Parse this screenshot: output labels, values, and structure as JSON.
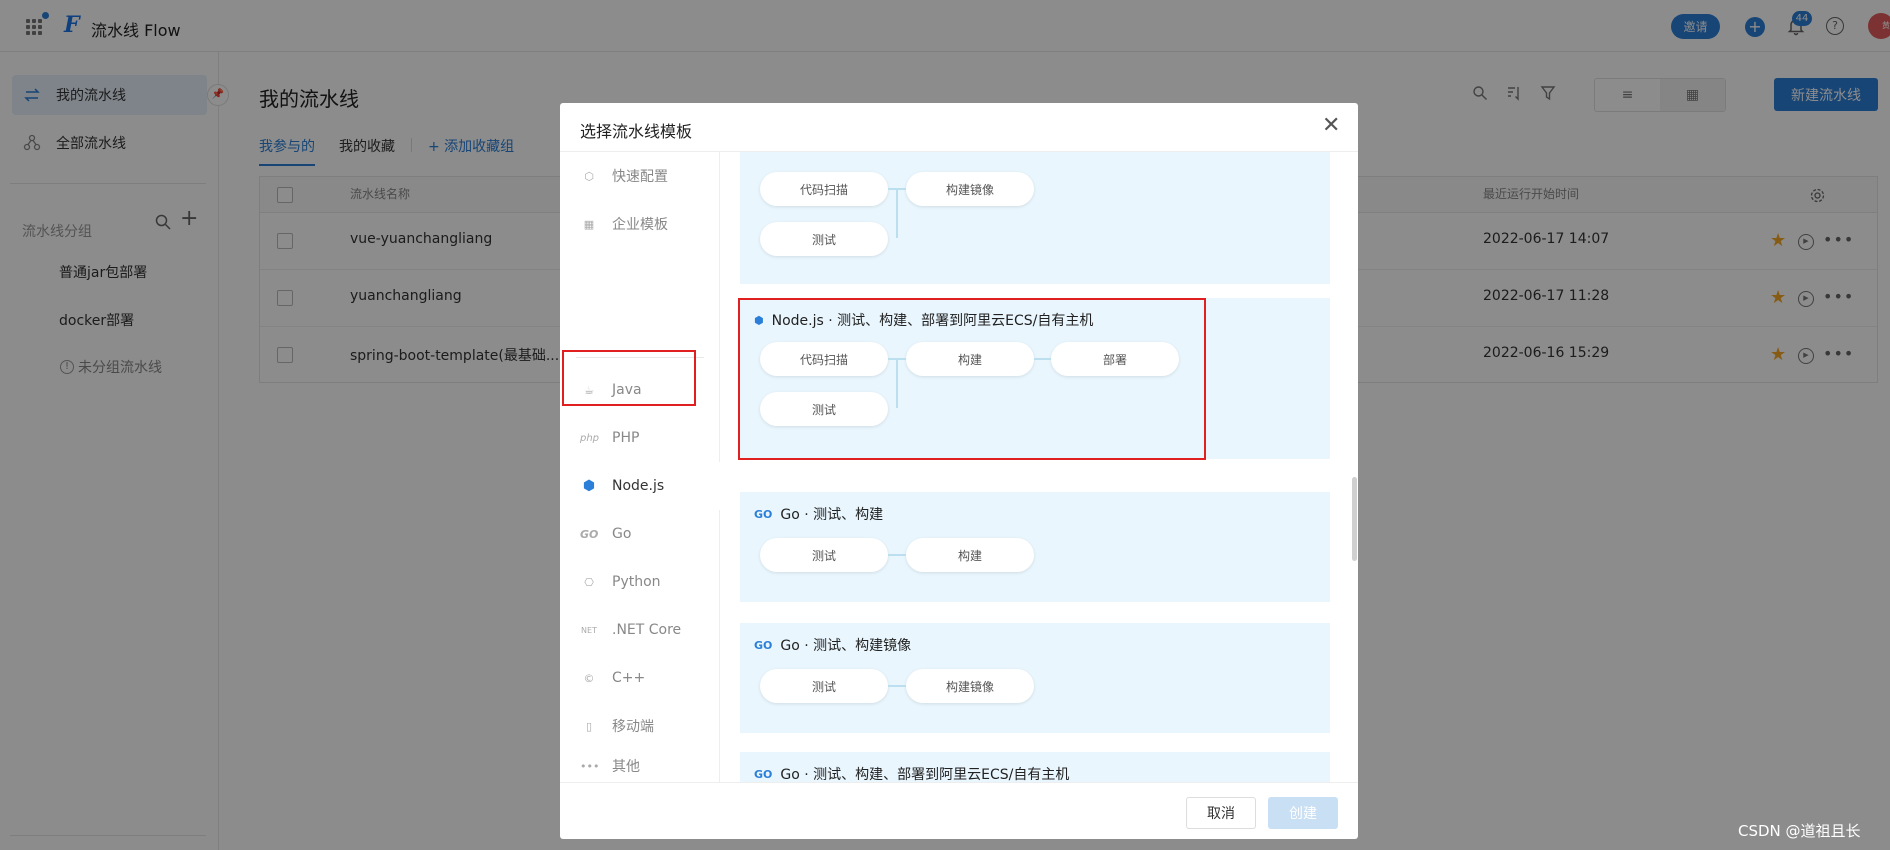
{
  "topbar": {
    "app_title": "流水线 Flow",
    "invite": "邀请",
    "notification_count": "44",
    "avatar_text": "黄"
  },
  "sidebar": {
    "my_pipelines": "我的流水线",
    "all_pipelines": "全部流水线",
    "group_title": "流水线分组",
    "groups": [
      "普通jar包部署",
      "docker部署"
    ],
    "ungrouped": "未分组流水线"
  },
  "main": {
    "title": "我的流水线",
    "tabs": [
      "我参与的",
      "我的收藏"
    ],
    "add_group": "+ 添加收藏组",
    "new_button": "新建流水线",
    "columns": {
      "name": "流水线名称",
      "last_run": "最近运行开始时间"
    },
    "rows": [
      {
        "name": "vue-yuanchangliang",
        "time": "2022-06-17 14:07"
      },
      {
        "name": "yuanchangliang",
        "time": "2022-06-17 11:28"
      },
      {
        "name": "spring-boot-template(最基础...",
        "time": "2022-06-16 15:29"
      }
    ]
  },
  "modal": {
    "title": "选择流水线模板",
    "nav": [
      "快速配置",
      "企业模板",
      "Java",
      "PHP",
      "Node.js",
      "Go",
      "Python",
      ".NET Core",
      "C++",
      "移动端",
      "其他"
    ],
    "selected_nav": "Node.js",
    "cards": [
      {
        "title": "",
        "stages": [
          "代码扫描",
          "构建镜像",
          "测试"
        ]
      },
      {
        "title": "Node.js · 测试、构建、部署到阿里云ECS/自有主机",
        "stages": [
          "代码扫描",
          "构建",
          "部署",
          "测试"
        ]
      },
      {
        "title": "Go · 测试、构建",
        "stages": [
          "测试",
          "构建"
        ]
      },
      {
        "title": "Go · 测试、构建镜像",
        "stages": [
          "测试",
          "构建镜像"
        ]
      },
      {
        "title": "Go · 测试、构建、部署到阿里云ECS/自有主机",
        "stages": []
      }
    ],
    "cancel": "取消",
    "create": "创建"
  },
  "watermark": "CSDN @道祖且长",
  "colors": {
    "primary": "#2b7fd8",
    "highlight": "#e02020",
    "card_bg": "#e9f6fd",
    "star": "#f5a623"
  }
}
